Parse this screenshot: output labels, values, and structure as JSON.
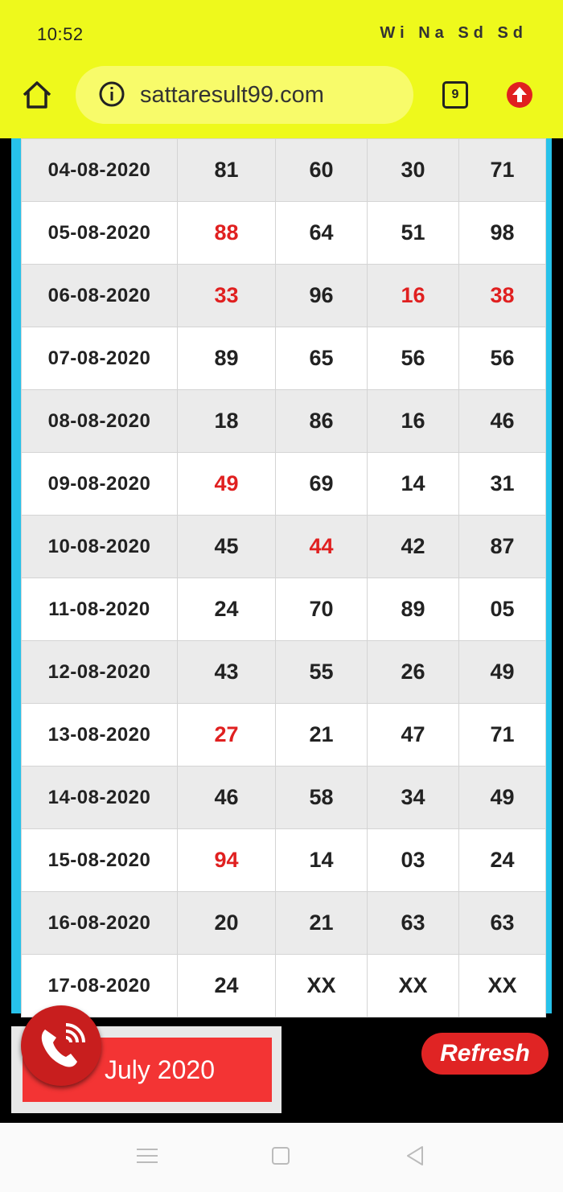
{
  "status_bar": {
    "time": "10:52",
    "indicators": "Wi Na Sd Sd"
  },
  "browser": {
    "url": "sattaresult99.com",
    "tab_count": "9",
    "icons": [
      "home-icon",
      "info-icon",
      "tabs-icon",
      "update-icon"
    ]
  },
  "table": {
    "rows": [
      {
        "date": "04-08-2020",
        "c1": "81",
        "c2": "60",
        "c3": "30",
        "c4": "71",
        "red": []
      },
      {
        "date": "05-08-2020",
        "c1": "88",
        "c2": "64",
        "c3": "51",
        "c4": "98",
        "red": [
          "c1"
        ]
      },
      {
        "date": "06-08-2020",
        "c1": "33",
        "c2": "96",
        "c3": "16",
        "c4": "38",
        "red": [
          "c1",
          "c3",
          "c4"
        ]
      },
      {
        "date": "07-08-2020",
        "c1": "89",
        "c2": "65",
        "c3": "56",
        "c4": "56",
        "red": []
      },
      {
        "date": "08-08-2020",
        "c1": "18",
        "c2": "86",
        "c3": "16",
        "c4": "46",
        "red": []
      },
      {
        "date": "09-08-2020",
        "c1": "49",
        "c2": "69",
        "c3": "14",
        "c4": "31",
        "red": [
          "c1"
        ]
      },
      {
        "date": "10-08-2020",
        "c1": "45",
        "c2": "44",
        "c3": "42",
        "c4": "87",
        "red": [
          "c2"
        ]
      },
      {
        "date": "11-08-2020",
        "c1": "24",
        "c2": "70",
        "c3": "89",
        "c4": "05",
        "red": []
      },
      {
        "date": "12-08-2020",
        "c1": "43",
        "c2": "55",
        "c3": "26",
        "c4": "49",
        "red": []
      },
      {
        "date": "13-08-2020",
        "c1": "27",
        "c2": "21",
        "c3": "47",
        "c4": "71",
        "red": [
          "c1"
        ]
      },
      {
        "date": "14-08-2020",
        "c1": "46",
        "c2": "58",
        "c3": "34",
        "c4": "49",
        "red": []
      },
      {
        "date": "15-08-2020",
        "c1": "94",
        "c2": "14",
        "c3": "03",
        "c4": "24",
        "red": [
          "c1"
        ]
      },
      {
        "date": "16-08-2020",
        "c1": "20",
        "c2": "21",
        "c3": "63",
        "c4": "63",
        "red": []
      },
      {
        "date": "17-08-2020",
        "c1": "24",
        "c2": "XX",
        "c3": "XX",
        "c4": "XX",
        "red": []
      }
    ],
    "colors": {
      "highlight": "#e02020",
      "shaded_row": "#ebebeb",
      "frame": "#27c2ea"
    }
  },
  "controls": {
    "month_label": "July 2020",
    "refresh_label": "Refresh"
  },
  "navbar": {
    "icons": [
      "menu-icon",
      "square-home-icon",
      "back-icon"
    ]
  }
}
